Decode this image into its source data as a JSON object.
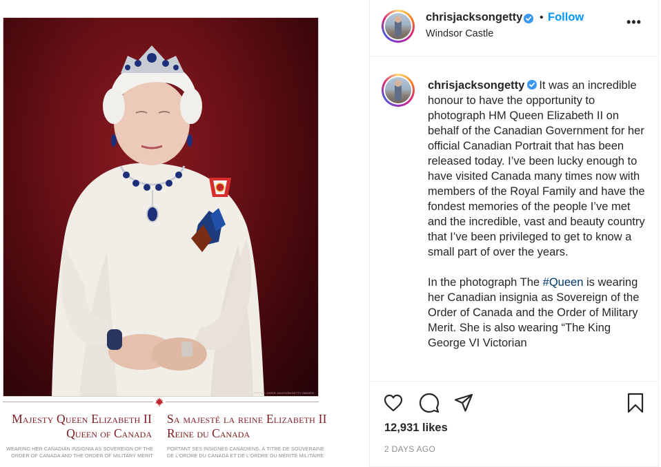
{
  "post": {
    "header": {
      "username": "chrisjacksongetty",
      "follow_label": "Follow",
      "separator": "•",
      "location": "Windsor Castle",
      "more_label": "•••"
    },
    "caption": {
      "username": "chrisjacksongetty",
      "paragraph1": "It was an incredible honour to have the opportunity to photograph HM Queen Elizabeth II on behalf of the Canadian Government for her official Canadian Portrait that has been released today. I’ve been lucky enough to have visited Canada many times now with members of the Royal Family and have the fondest memories of the people I’ve met and the incredible, vast and beauty country that I’ve been privileged to get to know a small part of over the years.",
      "paragraph2_before": "In the photograph The ",
      "paragraph2_hashtag": "#Queen",
      "paragraph2_after": " is wearing her Canadian insignia as Sovereign of the Order of Canada and the Order of Military Merit. She is also wearing “The King George VI Victorian"
    },
    "likes": "12,931 likes",
    "date": "2 DAYS AGO"
  },
  "image": {
    "caption_en_line1": "Majesty Queen Elizabeth II",
    "caption_en_line2": "Queen of Canada",
    "caption_fr_line1": "Sa majesté la reine Elizabeth II",
    "caption_fr_line2": "Reine du Canada",
    "sub_en_line1": "WEARING HER CANADIAN INSIGNIA AS SOVEREIGN OF THE",
    "sub_en_line2": "ORDER OF CANADA AND THE ORDER OF MILITARY MERIT",
    "sub_fr_line1": "PORTANT SES INSIGNES CANADIENS, À TITRE DE SOUVERAINE",
    "sub_fr_line2": "DE L'ORDRE DU CANADA ET DE L'ORDRE DU MÉRITE MILITAIRE",
    "photo_credit": "PHOTO: CHRIS JACKSON/GETTY IMAGES"
  },
  "icons": {
    "verified": "verified-badge-icon",
    "like": "heart-icon",
    "comment": "speech-bubble-icon",
    "share": "paper-plane-icon",
    "save": "bookmark-icon",
    "maple": "maple-leaf-icon"
  },
  "colors": {
    "link_blue": "#0095f6",
    "hashtag": "#00376b",
    "verified_blue": "#3897f0",
    "caption_red": "#7a1a1f"
  }
}
